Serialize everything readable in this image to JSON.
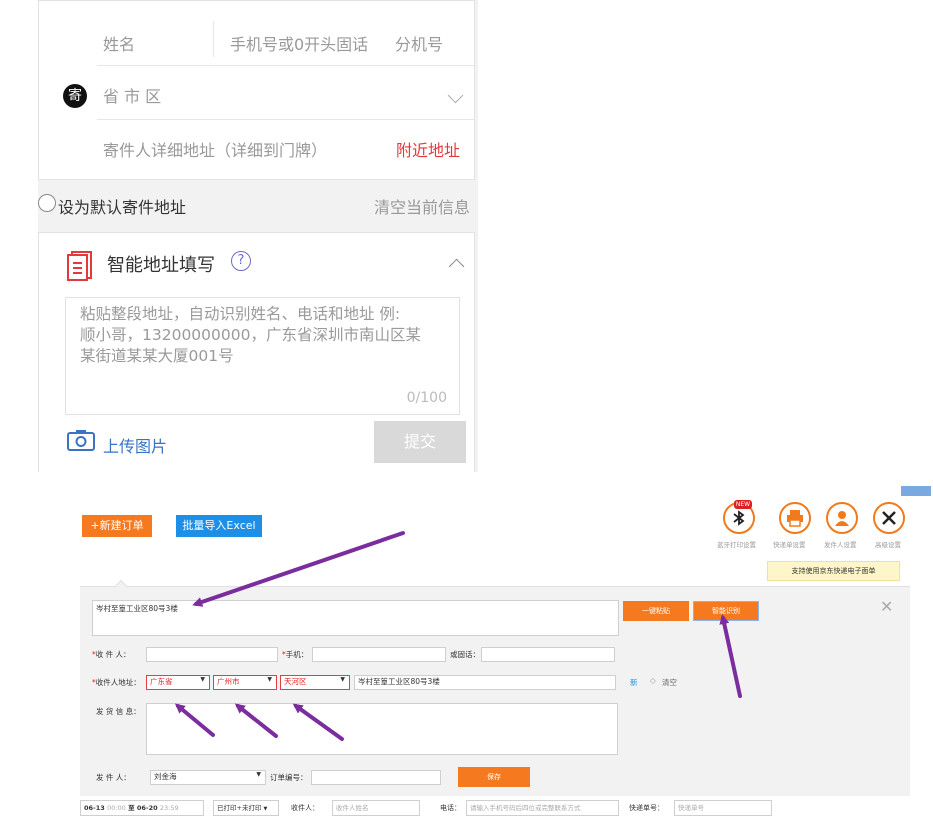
{
  "mobile_form": {
    "name_placeholder": "姓名",
    "phone_placeholder": "手机号或0开头固话",
    "ext_placeholder": "分机号",
    "sender_badge": "寄",
    "region_placeholder": "省 市 区",
    "detail_placeholder": "寄件人详细地址（详细到门牌）",
    "nearby_link": "附近地址",
    "default_label": "设为默认寄件地址",
    "clear_link": "清空当前信息",
    "smart_title": "智能地址填写",
    "smart_help": "?",
    "paste_placeholder": "粘贴整段地址，自动识别姓名、电话和地址 例:\n顺小哥，13200000000，广东省深圳市南山区某\n某街道某某大厦001号",
    "paste_count": "0/100",
    "upload_label": "上传图片",
    "submit_label": "提交"
  },
  "desktop_app": {
    "new_order": "+新建订单",
    "import_excel": "批量导入Excel",
    "new_badge": "NEW",
    "corner_badge": "",
    "tools": [
      {
        "label": "蓝牙打印设置",
        "icon": "bluetooth-icon"
      },
      {
        "label": "快递单设置",
        "icon": "printer-icon"
      },
      {
        "label": "发件人设置",
        "icon": "user-icon"
      },
      {
        "label": "高级设置",
        "icon": "tools-icon"
      }
    ],
    "tooltip": "支持使用京东快递电子面单",
    "paste_value": "岑村至篁工业区80号3楼",
    "paste_button": "一键粘贴",
    "recognize_button": "智能识别",
    "receiver_label": "收 件 人：",
    "mobile_label": "手机：",
    "landline_label": "或固话：",
    "address_label": "收件人地址：",
    "province": "广东省",
    "city": "广州市",
    "district": "天河区",
    "street_value": "岑村至篁工业区80号3楼",
    "new_link": "新",
    "clear_label": "清空",
    "goods_label": "发 货 信 息：",
    "sender_label": "发 件 人：",
    "sender_value": "刘金海",
    "order_no_label": "订单编号：",
    "save_button": "保存",
    "filter": {
      "date_start": "06-13",
      "time_start": "00:00",
      "to": "至",
      "date_end": "06-20",
      "time_end": "23:59",
      "print_status": "已打印+未打印",
      "receiver_label": "收件人：",
      "receiver_placeholder": "收件人姓名",
      "phone_label": "电话：",
      "phone_placeholder": "请输入手机号码后四位或完整联系方式",
      "tracking_label": "快递单号：",
      "tracking_placeholder": "快递单号"
    }
  },
  "colors": {
    "accent_orange": "#f57a1f",
    "accent_blue": "#1e8fe6",
    "error_red": "#e4393c",
    "arrow_purple": "#7b2d9e"
  }
}
